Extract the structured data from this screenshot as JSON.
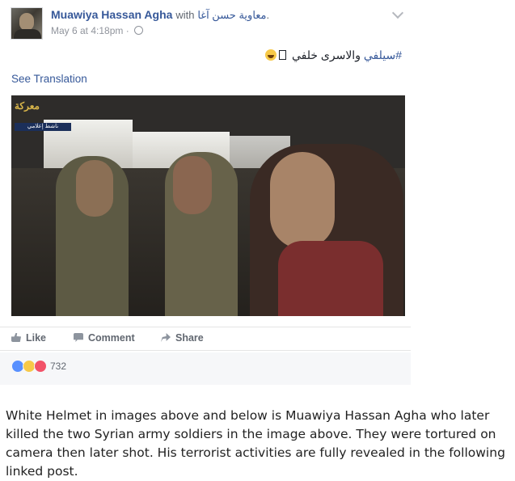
{
  "post": {
    "author": "Muawiya Hassan Agha",
    "with_word": "with",
    "tagged": "معاوية حسن آغا",
    "tagged_suffix": ".",
    "timestamp": "May 6 at 4:18pm · ",
    "hashtag": "#سيلفي",
    "text": " والاسرى خلفي ",
    "see_translation": "See Translation",
    "photo_watermark": "معركة",
    "photo_badge": "ناشط إعلامي"
  },
  "actions": {
    "like": "Like",
    "comment": "Comment",
    "share": "Share"
  },
  "reactions": {
    "count": "732",
    "types": [
      "like-icon",
      "haha-icon",
      "love-icon"
    ],
    "colors": {
      "like": "#5890ff",
      "haha": "#f7c948",
      "love": "#f25268"
    }
  },
  "caption": "White Helmet in images above and below is Muawiya Hassan Agha who later killed the two Syrian army soldiers in the image above. They were tortured on camera then later shot. His terrorist activities are fully revealed in the following linked post.",
  "colors": {
    "link": "#365899",
    "meta": "#90949c",
    "action": "#616770"
  }
}
